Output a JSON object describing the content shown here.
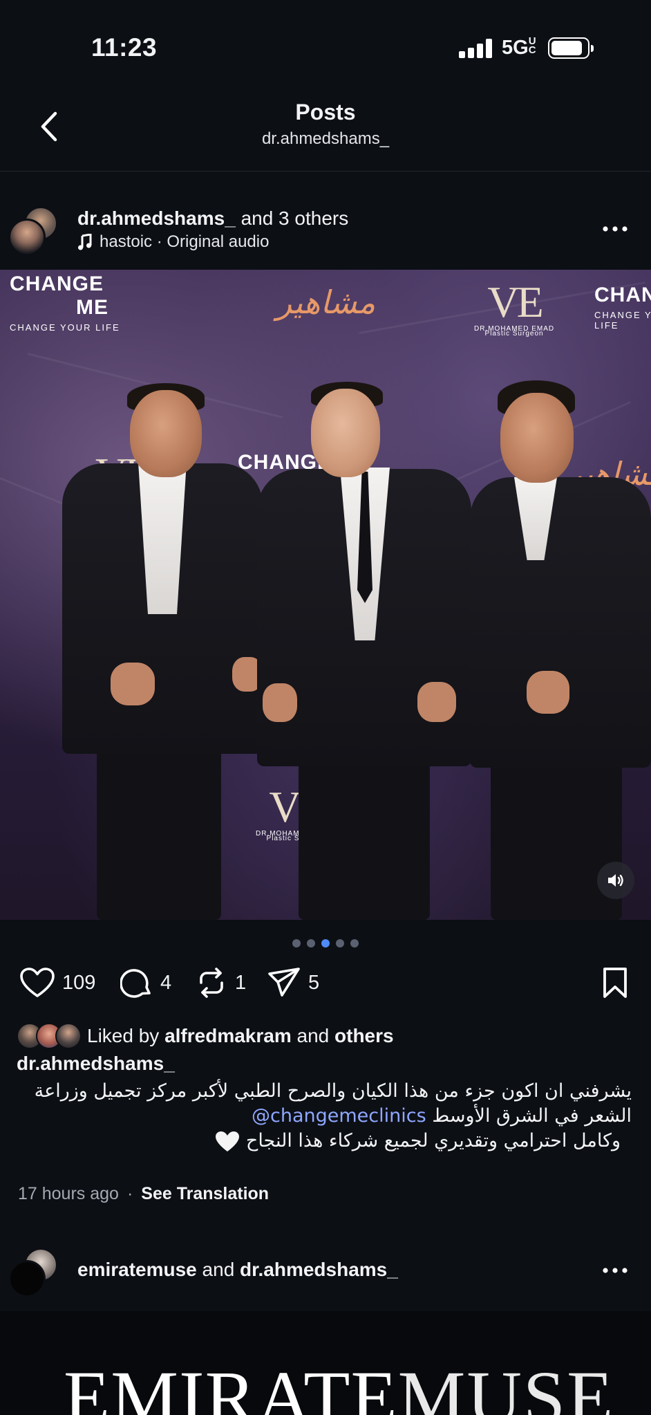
{
  "status_bar": {
    "time": "11:23",
    "network": "5G",
    "network_suffix": "UC"
  },
  "header": {
    "title": "Posts",
    "subtitle": "dr.ahmedshams_"
  },
  "post": {
    "author": "dr.ahmedshams_",
    "collab_text": "and 3 others",
    "audio": "hastoic · Original audio",
    "media_brands": {
      "change": "CHANGE",
      "me": "ME",
      "change_tagline": "CHANGE YOUR LIFE",
      "ve": "VE",
      "ve_name": "DR.MOHAMED EMAD",
      "ve_title": "Plastic Surgeon",
      "arabic_script": "مشاهير"
    },
    "carousel": {
      "count": 5,
      "active_index": 2
    },
    "actions": {
      "likes": "109",
      "comments": "4",
      "reposts": "1",
      "shares": "5"
    },
    "liked_by": {
      "prefix": "Liked by",
      "user": "alfredmakram",
      "and": "and",
      "others": "others"
    },
    "caption": {
      "user": "dr.ahmedshams_",
      "line1": "يشرفني ان اكون جزء من هذا الكيان والصرح الطبي لأكبر مركز تجميل وزراعة",
      "line2_text": "الشعر في الشرق الأوسط",
      "line2_mention": "@changemeclinics",
      "line3": "وكامل احترامي وتقديري لجميع شركاء  هذا النجاح"
    },
    "time_ago": "17 hours ago",
    "separator": "·",
    "see_translation": "See Translation"
  },
  "next_post": {
    "author": "emiratemuse",
    "and": "and",
    "coauthor": "dr.ahmedshams_",
    "wordmark_bold": "EMIRATE",
    "wordmark_thin": "MUSE"
  },
  "colors": {
    "background": "#0c0f14",
    "accent_blue": "#4f8bf8",
    "mention": "#8fa7ff",
    "muted": "#a5a9b2"
  },
  "icons": [
    "back-chevron-icon",
    "more-icon",
    "music-note-icon",
    "sound-icon",
    "heart-icon",
    "comment-icon",
    "repost-icon",
    "share-icon",
    "bookmark-icon",
    "white-heart-emoji-icon"
  ]
}
